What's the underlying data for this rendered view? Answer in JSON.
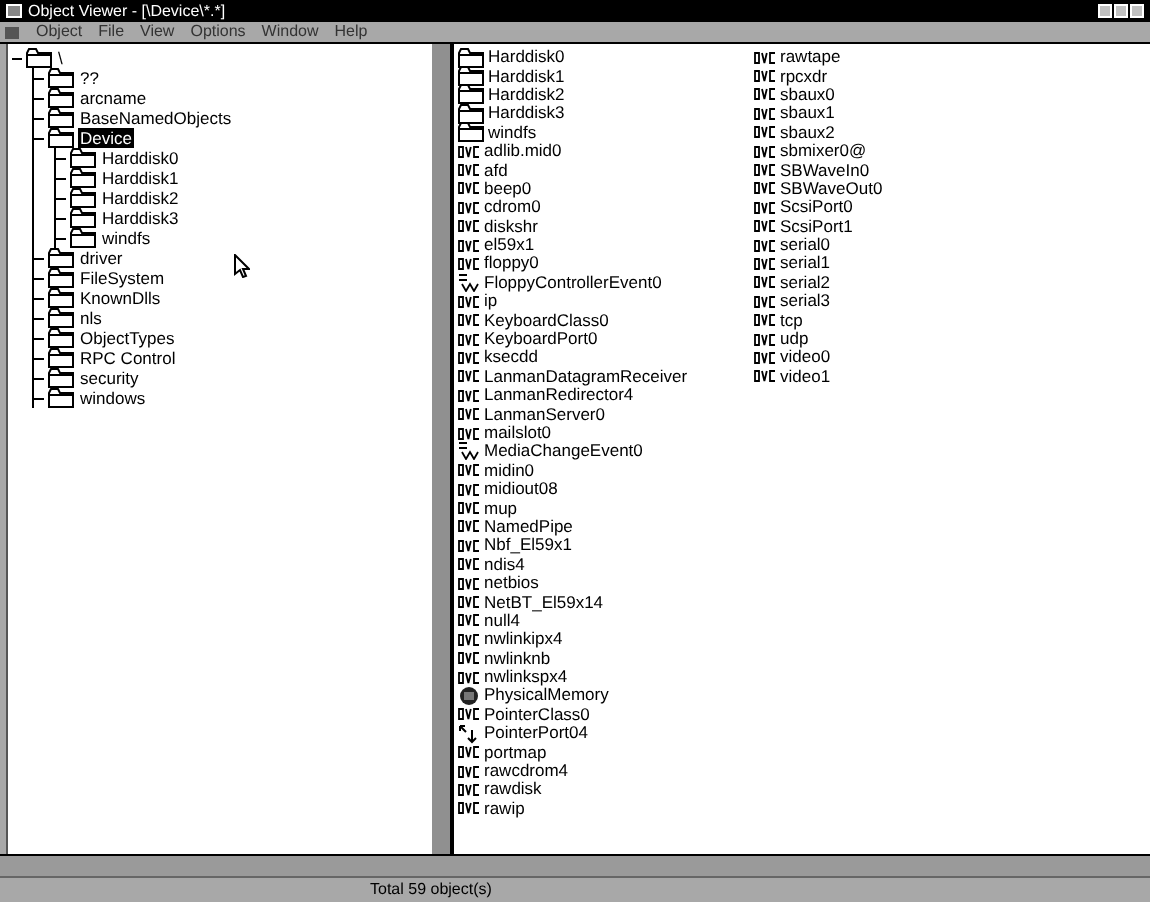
{
  "window": {
    "title": "Object Viewer - [\\Device\\*.*]"
  },
  "menu": [
    "Object",
    "File",
    "View",
    "Options",
    "Window",
    "Help"
  ],
  "tree": [
    {
      "label": "\\",
      "selected": false,
      "expanded": true,
      "children": [
        {
          "label": "??",
          "selected": false
        },
        {
          "label": "arcname",
          "selected": false
        },
        {
          "label": "BaseNamedObjects",
          "selected": false
        },
        {
          "label": "Device",
          "selected": true,
          "expanded": true,
          "children": [
            {
              "label": "Harddisk0",
              "selected": false
            },
            {
              "label": "Harddisk1",
              "selected": false
            },
            {
              "label": "Harddisk2",
              "selected": false
            },
            {
              "label": "Harddisk3",
              "selected": false
            },
            {
              "label": "windfs",
              "selected": false
            }
          ]
        },
        {
          "label": "driver",
          "selected": false
        },
        {
          "label": "FileSystem",
          "selected": false
        },
        {
          "label": "KnownDlls",
          "selected": false
        },
        {
          "label": "nls",
          "selected": false
        },
        {
          "label": "ObjectTypes",
          "selected": false
        },
        {
          "label": "RPC Control",
          "selected": false
        },
        {
          "label": "security",
          "selected": false
        },
        {
          "label": "windows",
          "selected": false
        }
      ]
    }
  ],
  "list_columns": [
    {
      "items": [
        {
          "name": "Harddisk0",
          "kind": "folder"
        },
        {
          "name": "Harddisk1",
          "kind": "folder"
        },
        {
          "name": "Harddisk2",
          "kind": "folder"
        },
        {
          "name": "Harddisk3",
          "kind": "folder"
        },
        {
          "name": "windfs",
          "kind": "folder"
        },
        {
          "name": "adlib.mid0",
          "kind": "device"
        },
        {
          "name": "afd",
          "kind": "device"
        },
        {
          "name": "beep0",
          "kind": "device"
        },
        {
          "name": "cdrom0",
          "kind": "device"
        },
        {
          "name": "diskshr",
          "kind": "device"
        },
        {
          "name": "el59x1",
          "kind": "device"
        },
        {
          "name": "floppy0",
          "kind": "device"
        },
        {
          "name": "FloppyControllerEvent0",
          "kind": "event"
        },
        {
          "name": "ip",
          "kind": "device"
        },
        {
          "name": "KeyboardClass0",
          "kind": "device"
        },
        {
          "name": "KeyboardPort0",
          "kind": "device"
        },
        {
          "name": "ksecdd",
          "kind": "device"
        },
        {
          "name": "LanmanDatagramReceiver",
          "kind": "device"
        },
        {
          "name": "LanmanRedirector4",
          "kind": "device"
        },
        {
          "name": "LanmanServer0",
          "kind": "device"
        },
        {
          "name": "mailslot0",
          "kind": "device"
        },
        {
          "name": "MediaChangeEvent0",
          "kind": "event"
        },
        {
          "name": "midin0",
          "kind": "device"
        },
        {
          "name": "midiout08",
          "kind": "device"
        },
        {
          "name": "mup",
          "kind": "device"
        },
        {
          "name": "NamedPipe",
          "kind": "device"
        },
        {
          "name": "Nbf_El59x1",
          "kind": "device"
        },
        {
          "name": "ndis4",
          "kind": "device"
        },
        {
          "name": "netbios",
          "kind": "device"
        },
        {
          "name": "NetBT_El59x14",
          "kind": "device"
        },
        {
          "name": "null4",
          "kind": "device"
        },
        {
          "name": "nwlinkipx4",
          "kind": "device"
        },
        {
          "name": "nwlinknb",
          "kind": "device"
        },
        {
          "name": "nwlinkspx4",
          "kind": "device"
        },
        {
          "name": "PhysicalMemory",
          "kind": "memory"
        },
        {
          "name": "PointerClass0",
          "kind": "device"
        },
        {
          "name": "PointerPort04",
          "kind": "link"
        },
        {
          "name": "portmap",
          "kind": "device"
        },
        {
          "name": "rawcdrom4",
          "kind": "device"
        },
        {
          "name": "rawdisk",
          "kind": "device"
        },
        {
          "name": "rawip",
          "kind": "device"
        }
      ]
    },
    {
      "items": [
        {
          "name": "rawtape",
          "kind": "device"
        },
        {
          "name": "rpcxdr",
          "kind": "device"
        },
        {
          "name": "sbaux0",
          "kind": "device"
        },
        {
          "name": "sbaux1",
          "kind": "device"
        },
        {
          "name": "sbaux2",
          "kind": "device"
        },
        {
          "name": "sbmixer0@",
          "kind": "device"
        },
        {
          "name": "SBWaveIn0",
          "kind": "device"
        },
        {
          "name": "SBWaveOut0",
          "kind": "device"
        },
        {
          "name": "ScsiPort0",
          "kind": "device"
        },
        {
          "name": "ScsiPort1",
          "kind": "device"
        },
        {
          "name": "serial0",
          "kind": "device"
        },
        {
          "name": "serial1",
          "kind": "device"
        },
        {
          "name": "serial2",
          "kind": "device"
        },
        {
          "name": "serial3",
          "kind": "device"
        },
        {
          "name": "tcp",
          "kind": "device"
        },
        {
          "name": "udp",
          "kind": "device"
        },
        {
          "name": "video0",
          "kind": "device"
        },
        {
          "name": "video1",
          "kind": "device"
        }
      ]
    }
  ],
  "status_bar": "Total 59 object(s)"
}
